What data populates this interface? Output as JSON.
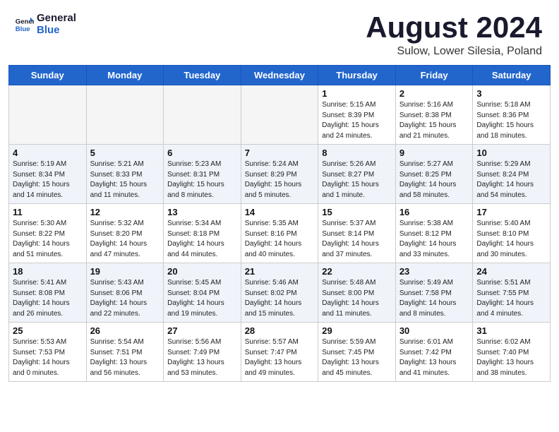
{
  "logo": {
    "line1": "General",
    "line2": "Blue"
  },
  "header": {
    "month_title": "August 2024",
    "subtitle": "Sulow, Lower Silesia, Poland"
  },
  "weekdays": [
    "Sunday",
    "Monday",
    "Tuesday",
    "Wednesday",
    "Thursday",
    "Friday",
    "Saturday"
  ],
  "weeks": [
    [
      {
        "day": "",
        "text": ""
      },
      {
        "day": "",
        "text": ""
      },
      {
        "day": "",
        "text": ""
      },
      {
        "day": "",
        "text": ""
      },
      {
        "day": "1",
        "text": "Sunrise: 5:15 AM\nSunset: 8:39 PM\nDaylight: 15 hours\nand 24 minutes."
      },
      {
        "day": "2",
        "text": "Sunrise: 5:16 AM\nSunset: 8:38 PM\nDaylight: 15 hours\nand 21 minutes."
      },
      {
        "day": "3",
        "text": "Sunrise: 5:18 AM\nSunset: 8:36 PM\nDaylight: 15 hours\nand 18 minutes."
      }
    ],
    [
      {
        "day": "4",
        "text": "Sunrise: 5:19 AM\nSunset: 8:34 PM\nDaylight: 15 hours\nand 14 minutes."
      },
      {
        "day": "5",
        "text": "Sunrise: 5:21 AM\nSunset: 8:33 PM\nDaylight: 15 hours\nand 11 minutes."
      },
      {
        "day": "6",
        "text": "Sunrise: 5:23 AM\nSunset: 8:31 PM\nDaylight: 15 hours\nand 8 minutes."
      },
      {
        "day": "7",
        "text": "Sunrise: 5:24 AM\nSunset: 8:29 PM\nDaylight: 15 hours\nand 5 minutes."
      },
      {
        "day": "8",
        "text": "Sunrise: 5:26 AM\nSunset: 8:27 PM\nDaylight: 15 hours\nand 1 minute."
      },
      {
        "day": "9",
        "text": "Sunrise: 5:27 AM\nSunset: 8:25 PM\nDaylight: 14 hours\nand 58 minutes."
      },
      {
        "day": "10",
        "text": "Sunrise: 5:29 AM\nSunset: 8:24 PM\nDaylight: 14 hours\nand 54 minutes."
      }
    ],
    [
      {
        "day": "11",
        "text": "Sunrise: 5:30 AM\nSunset: 8:22 PM\nDaylight: 14 hours\nand 51 minutes."
      },
      {
        "day": "12",
        "text": "Sunrise: 5:32 AM\nSunset: 8:20 PM\nDaylight: 14 hours\nand 47 minutes."
      },
      {
        "day": "13",
        "text": "Sunrise: 5:34 AM\nSunset: 8:18 PM\nDaylight: 14 hours\nand 44 minutes."
      },
      {
        "day": "14",
        "text": "Sunrise: 5:35 AM\nSunset: 8:16 PM\nDaylight: 14 hours\nand 40 minutes."
      },
      {
        "day": "15",
        "text": "Sunrise: 5:37 AM\nSunset: 8:14 PM\nDaylight: 14 hours\nand 37 minutes."
      },
      {
        "day": "16",
        "text": "Sunrise: 5:38 AM\nSunset: 8:12 PM\nDaylight: 14 hours\nand 33 minutes."
      },
      {
        "day": "17",
        "text": "Sunrise: 5:40 AM\nSunset: 8:10 PM\nDaylight: 14 hours\nand 30 minutes."
      }
    ],
    [
      {
        "day": "18",
        "text": "Sunrise: 5:41 AM\nSunset: 8:08 PM\nDaylight: 14 hours\nand 26 minutes."
      },
      {
        "day": "19",
        "text": "Sunrise: 5:43 AM\nSunset: 8:06 PM\nDaylight: 14 hours\nand 22 minutes."
      },
      {
        "day": "20",
        "text": "Sunrise: 5:45 AM\nSunset: 8:04 PM\nDaylight: 14 hours\nand 19 minutes."
      },
      {
        "day": "21",
        "text": "Sunrise: 5:46 AM\nSunset: 8:02 PM\nDaylight: 14 hours\nand 15 minutes."
      },
      {
        "day": "22",
        "text": "Sunrise: 5:48 AM\nSunset: 8:00 PM\nDaylight: 14 hours\nand 11 minutes."
      },
      {
        "day": "23",
        "text": "Sunrise: 5:49 AM\nSunset: 7:58 PM\nDaylight: 14 hours\nand 8 minutes."
      },
      {
        "day": "24",
        "text": "Sunrise: 5:51 AM\nSunset: 7:55 PM\nDaylight: 14 hours\nand 4 minutes."
      }
    ],
    [
      {
        "day": "25",
        "text": "Sunrise: 5:53 AM\nSunset: 7:53 PM\nDaylight: 14 hours\nand 0 minutes."
      },
      {
        "day": "26",
        "text": "Sunrise: 5:54 AM\nSunset: 7:51 PM\nDaylight: 13 hours\nand 56 minutes."
      },
      {
        "day": "27",
        "text": "Sunrise: 5:56 AM\nSunset: 7:49 PM\nDaylight: 13 hours\nand 53 minutes."
      },
      {
        "day": "28",
        "text": "Sunrise: 5:57 AM\nSunset: 7:47 PM\nDaylight: 13 hours\nand 49 minutes."
      },
      {
        "day": "29",
        "text": "Sunrise: 5:59 AM\nSunset: 7:45 PM\nDaylight: 13 hours\nand 45 minutes."
      },
      {
        "day": "30",
        "text": "Sunrise: 6:01 AM\nSunset: 7:42 PM\nDaylight: 13 hours\nand 41 minutes."
      },
      {
        "day": "31",
        "text": "Sunrise: 6:02 AM\nSunset: 7:40 PM\nDaylight: 13 hours\nand 38 minutes."
      }
    ]
  ]
}
